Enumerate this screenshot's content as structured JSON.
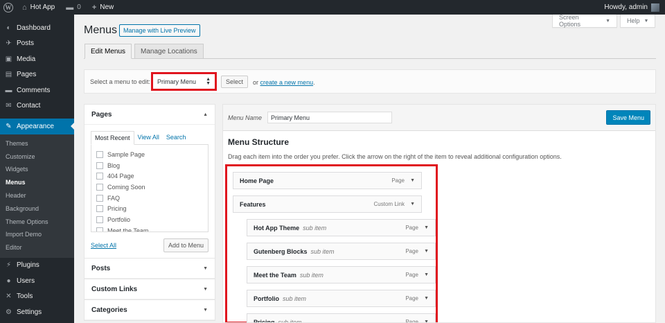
{
  "adminbar": {
    "site_name": "Hot App",
    "comments_count": "0",
    "new_label": "New",
    "howdy": "Howdy, admin"
  },
  "sidebar": {
    "top_items": [
      {
        "label": "Dashboard",
        "icon": "dashboard-icon"
      },
      {
        "label": "Posts",
        "icon": "pin-icon"
      },
      {
        "label": "Media",
        "icon": "media-icon"
      },
      {
        "label": "Pages",
        "icon": "pages-icon"
      },
      {
        "label": "Comments",
        "icon": "comment-icon"
      },
      {
        "label": "Contact",
        "icon": "mail-icon"
      }
    ],
    "active": {
      "label": "Appearance",
      "icon": "brush-icon"
    },
    "submenu": [
      "Themes",
      "Customize",
      "Widgets",
      "Menus",
      "Header",
      "Background",
      "Theme Options",
      "Import Demo",
      "Editor"
    ],
    "current_sub": "Menus",
    "bottom_items": [
      {
        "label": "Plugins",
        "icon": "plugin-icon"
      },
      {
        "label": "Users",
        "icon": "user-icon"
      },
      {
        "label": "Tools",
        "icon": "wrench-icon"
      },
      {
        "label": "Settings",
        "icon": "settings-icon"
      }
    ]
  },
  "header": {
    "title": "Menus",
    "live_preview": "Manage with Live Preview",
    "screen_options": "Screen Options",
    "help": "Help"
  },
  "tabs": [
    "Edit Menus",
    "Manage Locations"
  ],
  "select_bar": {
    "prompt": "Select a menu to edit:",
    "selected": "Primary Menu",
    "select_button": "Select",
    "or_text": "or",
    "create_link": "create a new menu",
    "period": "."
  },
  "pages_panel": {
    "title": "Pages",
    "tabs": [
      "Most Recent",
      "View All",
      "Search"
    ],
    "items": [
      "Sample Page",
      "Blog",
      "404 Page",
      "Coming Soon",
      "FAQ",
      "Pricing",
      "Portfolio",
      "Meet the Team"
    ],
    "select_all": "Select All",
    "add_button": "Add to Menu"
  },
  "collapsed_panels": [
    "Posts",
    "Custom Links",
    "Categories"
  ],
  "menu_editor": {
    "name_label": "Menu Name",
    "name_value": "Primary Menu",
    "save_button": "Save Menu",
    "structure_title": "Menu Structure",
    "instructions": "Drag each item into the order you prefer. Click the arrow on the right of the item to reveal additional configuration options.",
    "items": [
      {
        "name": "Home Page",
        "sub": "",
        "type": "Page",
        "level": 0
      },
      {
        "name": "Features",
        "sub": "",
        "type": "Custom Link",
        "level": 0
      },
      {
        "name": "Hot App Theme",
        "sub": "sub item",
        "type": "Page",
        "level": 1
      },
      {
        "name": "Gutenberg Blocks",
        "sub": "sub item",
        "type": "Page",
        "level": 1
      },
      {
        "name": "Meet the Team",
        "sub": "sub item",
        "type": "Page",
        "level": 1
      },
      {
        "name": "Portfolio",
        "sub": "sub item",
        "type": "Page",
        "level": 1
      },
      {
        "name": "Pricing",
        "sub": "sub item",
        "type": "Page",
        "level": 1
      }
    ]
  },
  "colors": {
    "admin_dark": "#23282d",
    "accent": "#0073aa",
    "highlight_red": "#e0141e"
  }
}
